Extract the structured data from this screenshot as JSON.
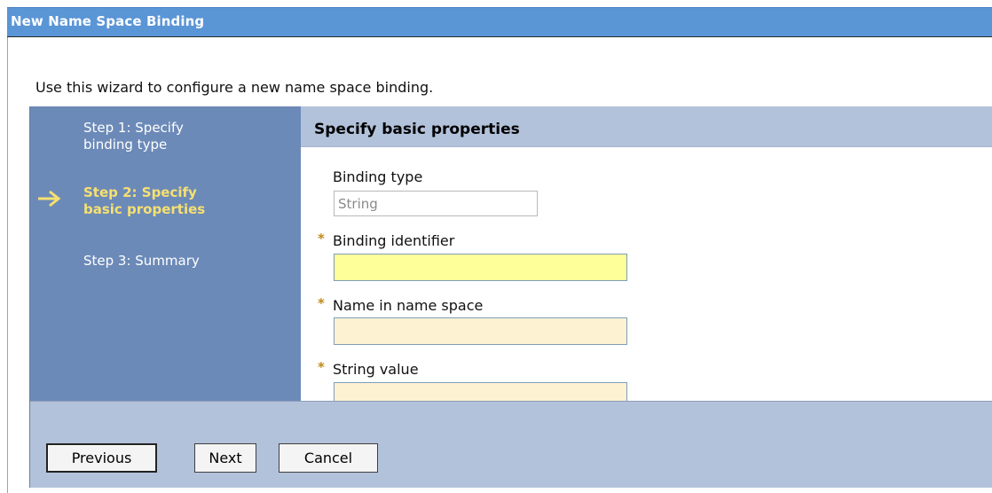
{
  "window": {
    "title": "New Name Space Binding"
  },
  "intro_text": "Use this wizard to configure a new name space binding.",
  "steps": [
    {
      "label": "Step 1: Specify binding type",
      "line1": "Step 1: Specify",
      "line2": "binding type",
      "active": false
    },
    {
      "label": "Step 2: Specify basic properties",
      "line1": "Step 2: Specify",
      "line2": "basic properties",
      "active": true
    },
    {
      "label": "Step 3: Summary",
      "line1": "Step 3: Summary",
      "line2": "",
      "active": false
    }
  ],
  "panel": {
    "heading": "Specify basic properties",
    "binding_type": {
      "label": "Binding type",
      "value": "String",
      "readonly": true
    },
    "binding_identifier": {
      "label": "Binding identifier",
      "value": "",
      "required": true
    },
    "name_in_name_space": {
      "label": "Name in name space",
      "value": "",
      "required": true
    },
    "string_value": {
      "label": "String value",
      "value": "",
      "required": true
    },
    "required_marker": "*"
  },
  "buttons": {
    "previous": "Previous",
    "next": "Next",
    "cancel": "Cancel"
  },
  "colors": {
    "titlebar": "#5a95d6",
    "steps_background": "#6c8ab8",
    "active_step": "#f6e071",
    "panel_header": "#b3c2db",
    "focused_field": "#ffff99",
    "required_field": "#fdf3d3",
    "required_marker": "#c08a18"
  },
  "icons": {
    "current_step": "right-arrow-icon"
  }
}
